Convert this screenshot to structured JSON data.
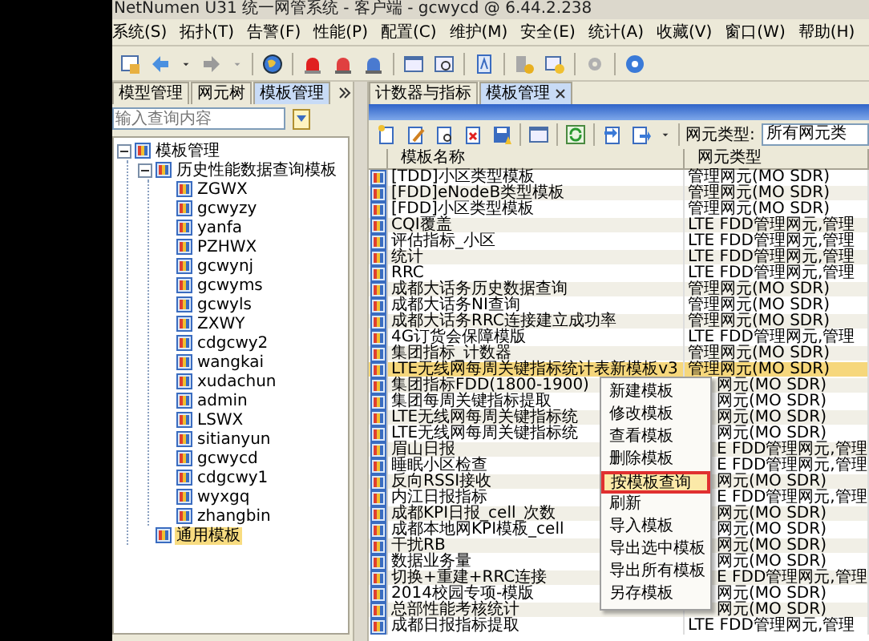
{
  "window": {
    "title": "NetNumen U31 统一网管系统 - 客户端 - gcwycd @ 6.44.2.238"
  },
  "menu": [
    "系统(S)",
    "拓扑(T)",
    "告警(F)",
    "性能(P)",
    "配置(C)",
    "维护(M)",
    "安全(E)",
    "统计(A)",
    "收藏(V)",
    "窗口(W)",
    "帮助(H)"
  ],
  "left_tabs": [
    {
      "label": "模型管理",
      "selected": false
    },
    {
      "label": "网元树",
      "selected": false
    },
    {
      "label": "模板管理",
      "selected": true
    }
  ],
  "search": {
    "placeholder": "输入查询内容"
  },
  "tree": [
    {
      "label": "模板管理",
      "selected": false,
      "expanded": true,
      "children": [
        {
          "label": "历史性能数据查询模板",
          "selected": false,
          "expanded": true,
          "children": [
            {
              "label": "ZGWX",
              "selected": false
            },
            {
              "label": "gcwyzy",
              "selected": false
            },
            {
              "label": "yanfa",
              "selected": false
            },
            {
              "label": "PZHWX",
              "selected": false
            },
            {
              "label": "gcwynj",
              "selected": false
            },
            {
              "label": "gcwyms",
              "selected": false
            },
            {
              "label": "gcwyls",
              "selected": false
            },
            {
              "label": "ZXWY",
              "selected": false
            },
            {
              "label": "cdgcwy2",
              "selected": false
            },
            {
              "label": "wangkai",
              "selected": false
            },
            {
              "label": "xudachun",
              "selected": false
            },
            {
              "label": "admin",
              "selected": false
            },
            {
              "label": "LSWX",
              "selected": false
            },
            {
              "label": "sitianyun",
              "selected": false
            },
            {
              "label": "gcwycd",
              "selected": false
            },
            {
              "label": "cdgcwy1",
              "selected": false
            },
            {
              "label": "wyxgq",
              "selected": false
            },
            {
              "label": "zhangbin",
              "selected": false
            }
          ]
        },
        {
          "label": "通用模板",
          "selected": true
        }
      ]
    }
  ],
  "right_tabs": [
    {
      "label": "计数器与指标",
      "selected": false,
      "closable": false
    },
    {
      "label": "模板管理",
      "selected": true,
      "closable": true
    }
  ],
  "filter": {
    "label": "网元类型:",
    "value": "所有网元类"
  },
  "table": {
    "columns": [
      "模板名称",
      "网元类型"
    ],
    "rows": [
      {
        "name": "[TDD]小区类型模板",
        "type": "管理网元(MO SDR)",
        "selected": false
      },
      {
        "name": "[FDD]eNodeB类型模板",
        "type": "管理网元(MO SDR)",
        "selected": false
      },
      {
        "name": "[FDD]小区类型模板",
        "type": "管理网元(MO SDR)",
        "selected": false
      },
      {
        "name": "CQI覆盖",
        "type": "LTE FDD管理网元,管理",
        "selected": false
      },
      {
        "name": "评估指标_小区",
        "type": "LTE FDD管理网元,管理",
        "selected": false
      },
      {
        "name": "统计",
        "type": "LTE FDD管理网元,管理",
        "selected": false
      },
      {
        "name": "RRC",
        "type": "LTE FDD管理网元,管理",
        "selected": false
      },
      {
        "name": "成都大话务历史数据查询",
        "type": "管理网元(MO SDR)",
        "selected": false
      },
      {
        "name": "成都大话务NI查询",
        "type": "管理网元(MO SDR)",
        "selected": false
      },
      {
        "name": "成都大话务RRC连接建立成功率",
        "type": "管理网元(MO SDR)",
        "selected": false
      },
      {
        "name": "4G订货会保障模版",
        "type": "LTE FDD管理网元,管理",
        "selected": false
      },
      {
        "name": "集团指标_计数器",
        "type": "管理网元(MO SDR)",
        "selected": false
      },
      {
        "name": "LTE无线网每周关键指标统计表新模板v3",
        "type": "管理网元(MO SDR)",
        "selected": true
      },
      {
        "name": "集团指标FDD(1800-1900)",
        "type": "网元(MO SDR)",
        "selected": false
      },
      {
        "name": "集团每周关键指标提取",
        "type": "网元(MO SDR)",
        "selected": false
      },
      {
        "name": "LTE无线网每周关键指标统",
        "type": "网元(MO SDR)",
        "selected": false
      },
      {
        "name": "LTE无线网每周关键指标统",
        "type": "网元(MO SDR)",
        "selected": false
      },
      {
        "name": "眉山日报",
        "type": "E FDD管理网元,管理",
        "selected": false
      },
      {
        "name": "睡眠小区检查",
        "type": "E FDD管理网元,管理",
        "selected": false
      },
      {
        "name": "反向RSSI接收",
        "type": "网元(MO SDR)",
        "selected": false
      },
      {
        "name": "内江日报指标",
        "type": "E FDD管理网元,管理",
        "selected": false
      },
      {
        "name": "成都KPI日报_cell_次数",
        "type": "网元(MO SDR)",
        "selected": false
      },
      {
        "name": "成都本地网KPI模板_cell",
        "type": "网元(MO SDR)",
        "selected": false
      },
      {
        "name": "干扰RB",
        "type": "网元(MO SDR)",
        "selected": false
      },
      {
        "name": "数据业务量",
        "type": "网元(MO SDR)",
        "selected": false
      },
      {
        "name": "切换+重建+RRC连接",
        "type": "E FDD管理网元,管理",
        "selected": false
      },
      {
        "name": "2014校园专项-模版",
        "type": "网元(MO SDR)",
        "selected": false
      },
      {
        "name": "总部性能考核统计",
        "type": "网元(MO SDR)",
        "selected": false
      },
      {
        "name": "成都日报指标提取",
        "type": "LTE FDD管理网元,管理",
        "selected": false
      }
    ]
  },
  "context_menu": [
    {
      "label": "新建模板",
      "selected": false
    },
    {
      "label": "修改模板",
      "selected": false
    },
    {
      "label": "查看模板",
      "selected": false
    },
    {
      "label": "删除模板",
      "selected": false
    },
    {
      "label": "按模板查询",
      "selected": true
    },
    {
      "label": "刷新",
      "selected": false
    },
    {
      "label": "导入模板",
      "selected": false
    },
    {
      "label": "导出选中模板",
      "selected": false
    },
    {
      "label": "导出所有模板",
      "selected": false
    },
    {
      "label": "另存模板",
      "selected": false
    }
  ]
}
